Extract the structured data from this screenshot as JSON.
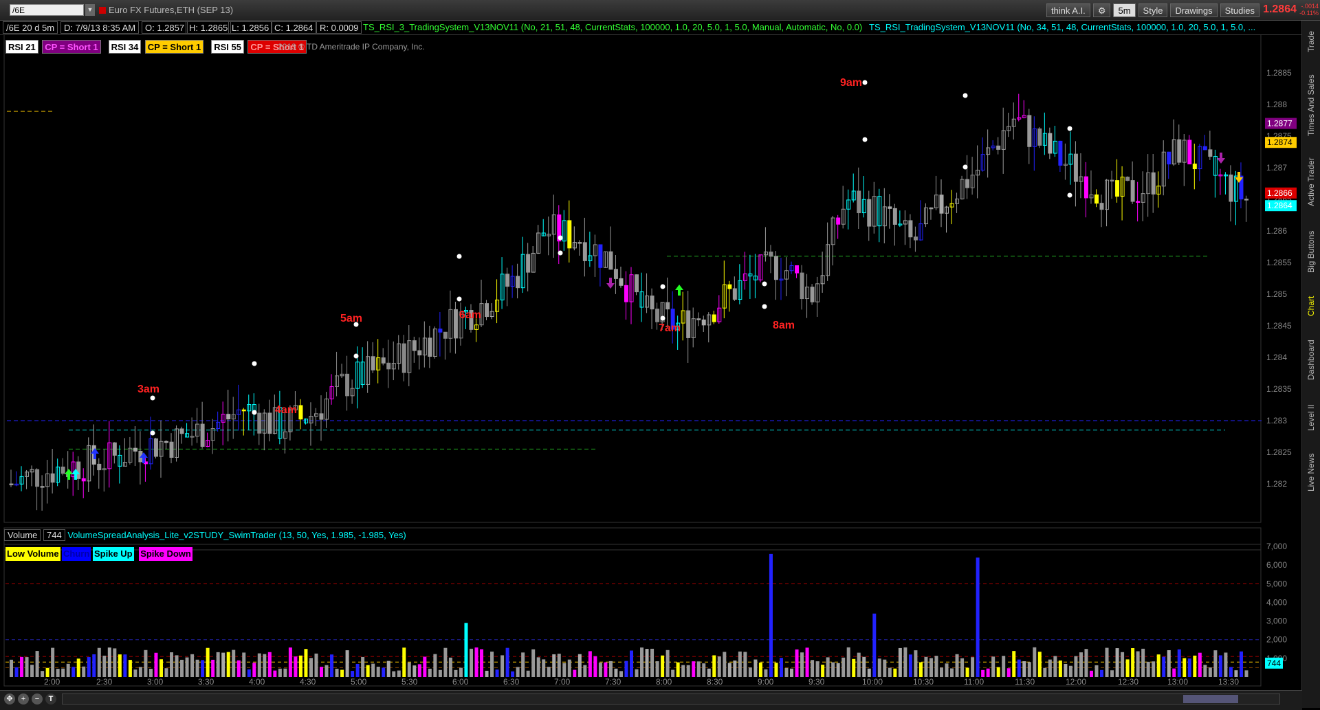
{
  "toolbar": {
    "symbol": "/6E",
    "instrument": "Euro FX Futures,ETH (SEP 13)",
    "think_ai": "think A.I.",
    "period": "5m",
    "style": "Style",
    "drawings": "Drawings",
    "studies": "Studies",
    "last_price": "1.2864",
    "change_abs": "-.0014",
    "change_pct": "-0.11%"
  },
  "infobar": {
    "chart_id": "/6E 20 d 5m",
    "date": "D: 7/9/13 8:35 AM",
    "open": "O: 1.2857",
    "high": "H: 1.2865",
    "low": "L: 1.2856",
    "close": "C: 1.2864",
    "range": "R: 0.0009",
    "study1": "TS_RSI_3_TradingSystem_V13NOV11 (No, 21, 51, 48, CurrentStats, 100000, 1.0, 20, 5.0, 1, 5.0, Manual, Automatic, No, 0.0)",
    "study2": "TS_RSI_TradingSystem_V13NOV11 (No, 34, 51, 48, CurrentStats, 100000, 1.0, 20, 5.0, 1, 5.0, ..."
  },
  "legend": [
    {
      "text": "RSI 21",
      "bg": "#ffffff",
      "fg": "#000000"
    },
    {
      "text": "CP = Short 1",
      "bg": "#800080",
      "fg": "#ff55ff"
    },
    {
      "text": "RSI 34",
      "bg": "#ffffff",
      "fg": "#000000"
    },
    {
      "text": "CP = Short 1",
      "bg": "#ffcc00",
      "fg": "#000000"
    },
    {
      "text": "RSI 55",
      "bg": "#ffffff",
      "fg": "#000000"
    },
    {
      "text": "CP = Short 1",
      "bg": "#dd0000",
      "fg": "#ff9999"
    }
  ],
  "copyright": "2013 © TD Ameritrade IP Company, Inc.",
  "side_tabs": [
    "Trade",
    "Times And Sales",
    "Active Trader",
    "Big Buttons",
    "Chart",
    "Dashboard",
    "Level II",
    "Live News"
  ],
  "chart_data": [
    {
      "type": "candlestick",
      "ylim": [
        1.2815,
        1.289
      ],
      "y_ticks": [
        "1.2885",
        "1.288",
        "1.2875",
        "1.287",
        "1.2865",
        "1.286",
        "1.2855",
        "1.285",
        "1.2845",
        "1.284",
        "1.2835",
        "1.283",
        "1.2825",
        "1.282"
      ],
      "price_labels": [
        {
          "value": "1.2877",
          "color": "#800080"
        },
        {
          "value": "1.2874",
          "color": "#ffcc00"
        },
        {
          "value": "1.2866",
          "color": "#dd0000"
        },
        {
          "value": "1.2864",
          "color": "#00ffff"
        }
      ],
      "annotations": [
        "9am",
        "3am",
        "4am",
        "5am",
        "6am",
        "7am",
        "8am"
      ],
      "close_path": [
        1.282,
        1.2822,
        1.2823,
        1.2824,
        1.2826,
        1.2827,
        1.2829,
        1.2832,
        1.2829,
        1.2831,
        1.2836,
        1.2838,
        1.2841,
        1.2845,
        1.2848,
        1.2852,
        1.286,
        1.2859,
        1.2855,
        1.2847,
        1.2845,
        1.2848,
        1.2852,
        1.2855,
        1.285,
        1.2865,
        1.2863,
        1.2858,
        1.2865,
        1.287,
        1.2878,
        1.2873,
        1.2869,
        1.2865,
        1.2867,
        1.2873,
        1.2869,
        1.2865
      ],
      "x_ticks": [
        "2:00",
        "2:30",
        "3:00",
        "3:30",
        "4:00",
        "4:30",
        "5:00",
        "5:30",
        "6:00",
        "6:30",
        "7:00",
        "7:30",
        "8:00",
        "8:30",
        "9:00",
        "9:30",
        "10:00",
        "10:30",
        "11:00",
        "11:30",
        "12:00",
        "12:30",
        "13:00",
        "13:30"
      ]
    },
    {
      "type": "bar",
      "title": "VolumeSpreadAnalysis_Lite_v2STUDY_SwimTrader (13, 50, Yes, 1.985, -1.985, Yes)",
      "volume_label": "Volume",
      "volume_value": "744",
      "y_ticks": [
        "7,000",
        "6,000",
        "5,000",
        "4,000",
        "3,000",
        "2,000",
        "1,000"
      ],
      "ylim": [
        0,
        7000
      ],
      "legend": [
        {
          "text": "Low Volume",
          "bg": "#ffff00",
          "fg": "#000000"
        },
        {
          "text": "Churn",
          "bg": "#0000ff",
          "fg": "#0000aa"
        },
        {
          "text": "Spike Up",
          "bg": "#00ffff",
          "fg": "#000000"
        },
        {
          "text": "Spike Down",
          "bg": "#ff00ff",
          "fg": "#000000"
        }
      ],
      "current_value": "744",
      "peaks": [
        {
          "x": "9:00",
          "value": 6600
        },
        {
          "x": "11:00",
          "value": 6400
        },
        {
          "x": "6:00",
          "value": 2900
        },
        {
          "x": "10:00",
          "value": 3400
        }
      ]
    }
  ]
}
